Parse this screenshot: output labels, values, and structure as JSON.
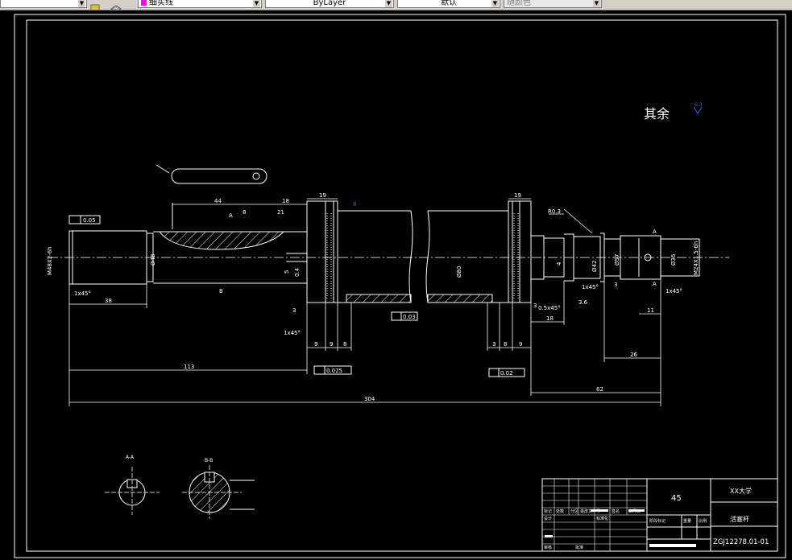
{
  "toolbar": {
    "layer_value": "细实线",
    "linetype_value": "ByLayer",
    "lineweight_value": "默认",
    "plotstyle_value": "随颜色",
    "swatch_color": "#ff00ff"
  },
  "colors": {
    "background": "#000000",
    "lines": "#ffffff",
    "center": "#c8c8c8",
    "blue_mark": "#3b5bff"
  },
  "drawing": {
    "roughness_note": "其余",
    "roughness_value": "6.3",
    "dims": {
      "d44": "44",
      "d18": "18",
      "d19a": "19",
      "d19b": "19",
      "d38": "38",
      "d113": "113",
      "d304": "304",
      "d62": "62",
      "d26": "26",
      "d11": "11",
      "d18b": "18",
      "d9a": "9",
      "d9b": "9",
      "d8a": "8",
      "d3a": "3",
      "d3b": "3",
      "d8b": "8",
      "d9c": "9",
      "d3c": "3",
      "d3d": "3",
      "d8c": "8",
      "d21": "21",
      "d4": "4",
      "d5": "5",
      "d04": "0.4",
      "r03": "R0.3",
      "chamfer1": "1x45°",
      "chamfer2": "1x45°",
      "chamfer3": "1x45°",
      "chamfer4": "1x45°",
      "chamfer5": "0.5x45°",
      "phi48": "Ø48",
      "phi80": "Ø80",
      "phi57": "Ø57",
      "phi35": "Ø35",
      "phi42": "Ø42",
      "thread1": "M48X2-6h",
      "thread2": "M24X1.5-6h",
      "dim36": "3.6",
      "tol01": "0.05",
      "tol02": "0.03",
      "tol03": "0.025",
      "tol04": "0.02",
      "key_r": "R0.3",
      "a_label": "A",
      "b_label": "B",
      "section_aa": "A-A",
      "section_bb": "B-B"
    },
    "title_block": {
      "material": "45",
      "school": "XX大学",
      "part_name": "活塞杆",
      "drawing_no": "ZGJ12278.01-01",
      "h_biaoji": "标记",
      "h_chushu": "处数",
      "h_fenqu": "分区",
      "h_gaiwen": "更改文件号",
      "h_qianming": "签名",
      "h_riqi": "年月日",
      "r_sheji": "设计",
      "r_biaozhunhua": "标准化",
      "r_jieduan": "阶段标记",
      "r_zhongliang": "重量",
      "r_bili": "比例",
      "r_shenhe": "审核",
      "r_gongyi": "工艺",
      "r_pizhun": "批准",
      "r_shenheA": "审核"
    }
  }
}
